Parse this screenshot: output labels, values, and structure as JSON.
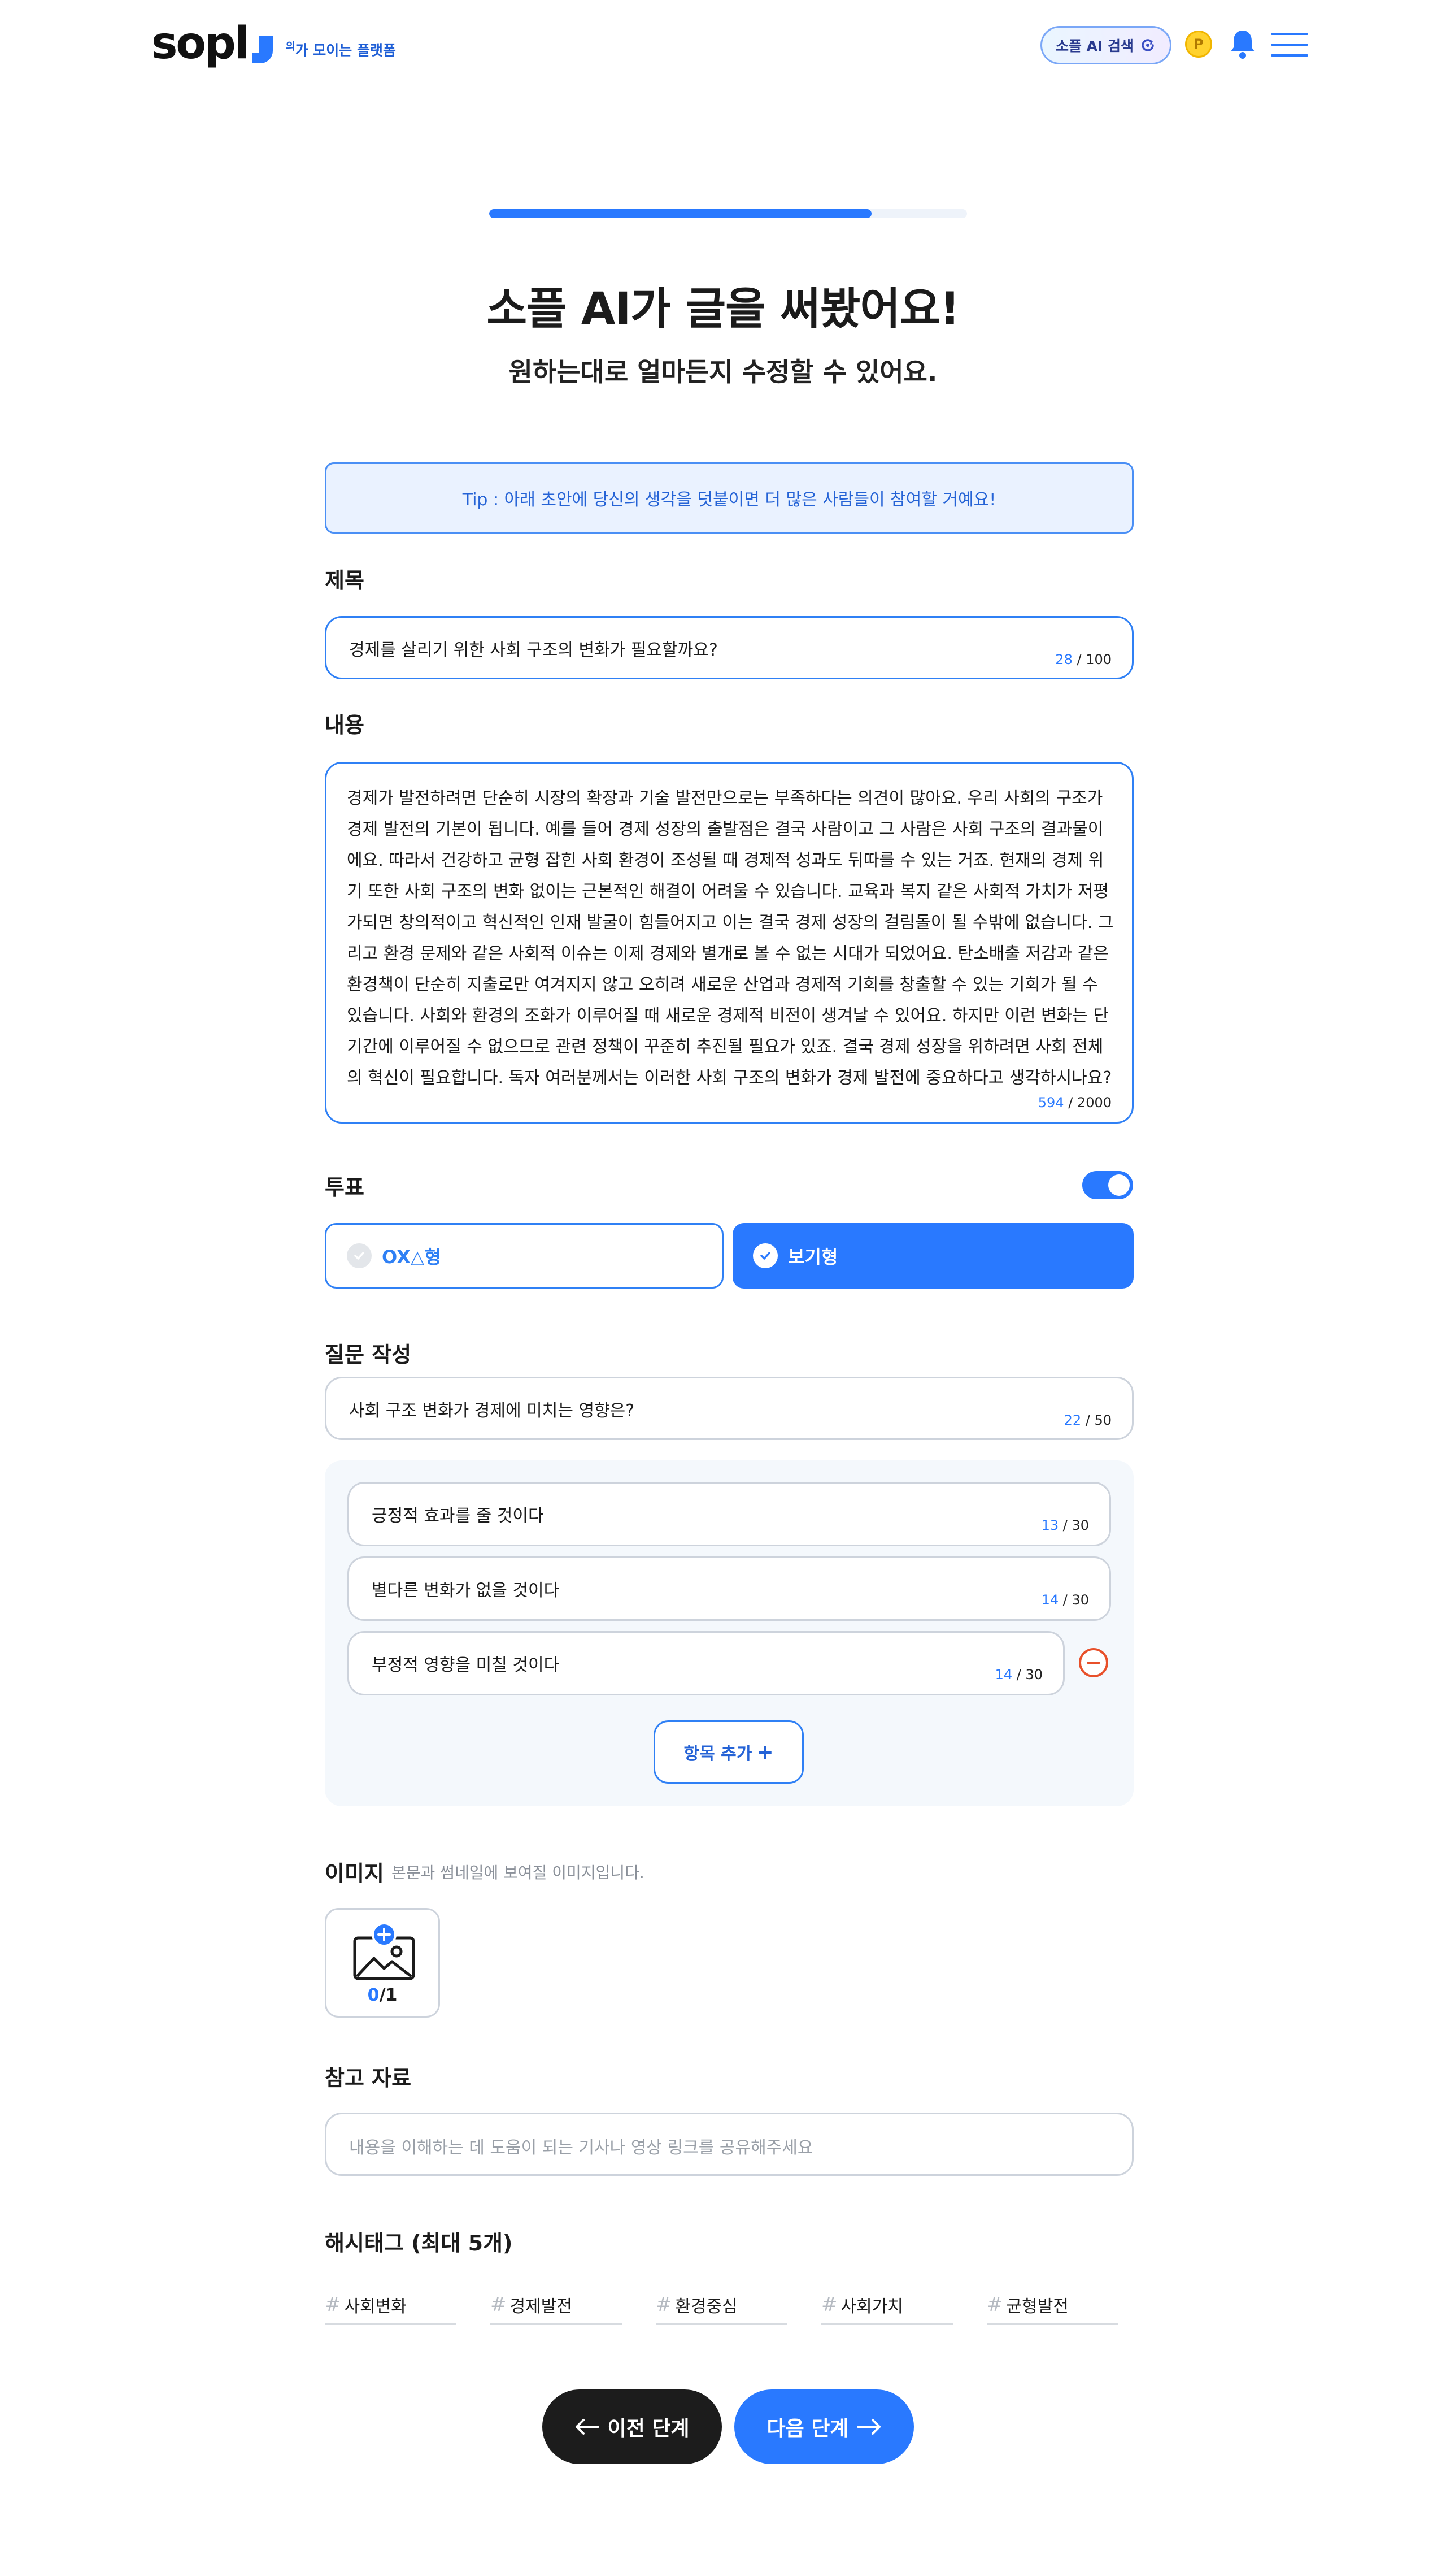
{
  "header": {
    "logo": "sopl",
    "tagline_sup": "의",
    "tagline": "가 모이는 플랫폼",
    "ai_search_label": "소플 AI 검색",
    "coin_label": "P"
  },
  "progress": {
    "fraction": 0.8
  },
  "heading": {
    "title": "소플 AI가 글을 써봤어요!",
    "subtitle": "원하는대로 얼마든지 수정할 수 있어요."
  },
  "tip": "Tip : 아래 초안에 당신의 생각을 덧붙이면 더 많은 사람들이 참여할 거예요!",
  "title_field": {
    "label": "제목",
    "value": "경제를 살리기 위한 사회 구조의 변화가 필요할까요?",
    "count": "28",
    "max": " / 100"
  },
  "content_field": {
    "label": "내용",
    "value": "경제가 발전하려면 단순히 시장의 확장과 기술 발전만으로는 부족하다는 의견이 많아요. 우리 사회의 구조가 경제 발전의 기본이 됩니다. 예를 들어 경제 성장의 출발점은 결국 사람이고 그 사람은 사회 구조의 결과물이에요. 따라서 건강하고 균형 잡힌 사회 환경이 조성될 때 경제적 성과도 뒤따를 수 있는 거죠. 현재의 경제 위기 또한 사회 구조의 변화 없이는 근본적인 해결이 어려울 수 있습니다. 교육과 복지 같은 사회적 가치가 저평가되면 창의적이고 혁신적인 인재 발굴이 힘들어지고 이는 결국 경제 성장의 걸림돌이 될 수밖에 없습니다. 그리고 환경 문제와 같은 사회적 이슈는 이제 경제와 별개로 볼 수 없는 시대가 되었어요. 탄소배출 저감과 같은 환경책이 단순히 지출로만 여겨지지 않고 오히려 새로운 산업과 경제적 기회를 창출할 수 있는 기회가 될 수 있습니다. 사회와 환경의 조화가 이루어질 때 새로운 경제적 비전이 생겨날 수 있어요. 하지만 이런 변화는 단기간에 이루어질 수 없으므로 관련 정책이 꾸준히 추진될 필요가 있죠. 결국 경제 성장을 위하려면 사회 전체의 혁신이 필요합니다. 독자 여러분께서는 이러한 사회 구조의 변화가 경제 발전에 중요하다고 생각하시나요?",
    "count": "594",
    "max": " / 2000"
  },
  "vote": {
    "label": "투표",
    "enabled": true,
    "type_ox": "OX△형",
    "type_choice": "보기형",
    "selected": "보기형"
  },
  "question": {
    "label": "질문 작성",
    "value": "사회 구조 변화가 경제에 미치는 영향은?",
    "count": "22",
    "max": " / 50"
  },
  "options": [
    {
      "value": "긍정적 효과를 줄 것이다",
      "count": "13",
      "max": " / 30"
    },
    {
      "value": "별다른 변화가 없을 것이다",
      "count": "14",
      "max": " / 30"
    },
    {
      "value": "부정적 영향을 미칠 것이다",
      "count": "14",
      "max": " / 30"
    }
  ],
  "add_option_label": "항목 추가",
  "image": {
    "label": "이미지",
    "sub": "본문과 썸네일에 보여질 이미지입니다.",
    "count": "0",
    "max": "/1"
  },
  "reference": {
    "label": "참고 자료",
    "placeholder": "내용을 이해하는 데 도움이 되는 기사나 영상 링크를 공유해주세요"
  },
  "hashtags": {
    "label": "해시태그 (최대 5개)",
    "items": [
      "사회변화",
      "경제발전",
      "환경중심",
      "사회가치",
      "균형발전"
    ]
  },
  "nav": {
    "prev": "이전 단계",
    "next": "다음 단계"
  },
  "colors": {
    "accent": "#2979ff",
    "danger": "#e8502a"
  },
  "icons": [
    "ai-search-icon",
    "coin-icon",
    "bell-icon",
    "menu-icon",
    "check-icon",
    "minus-circle-icon",
    "image-upload-icon",
    "hash-icon",
    "arrow-left-icon",
    "arrow-right-icon"
  ]
}
